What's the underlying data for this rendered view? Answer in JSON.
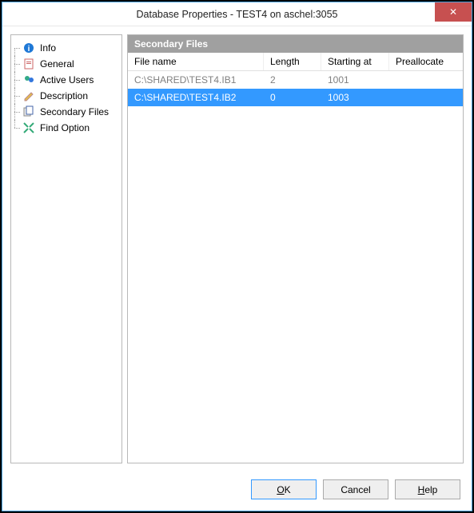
{
  "window": {
    "title": "Database Properties - TEST4 on aschel:3055"
  },
  "nav": {
    "items": [
      {
        "label": "Info"
      },
      {
        "label": "General"
      },
      {
        "label": "Active Users"
      },
      {
        "label": "Description"
      },
      {
        "label": "Secondary Files",
        "selected": true
      },
      {
        "label": "Find Option"
      }
    ]
  },
  "panel": {
    "title": "Secondary Files"
  },
  "table": {
    "columns": {
      "file_name": "File name",
      "length": "Length",
      "starting_at": "Starting at",
      "preallocate": "Preallocate"
    },
    "rows": [
      {
        "file_name": "C:\\SHARED\\TEST4.IB1",
        "length": "2",
        "starting_at": "1001",
        "preallocate": "",
        "selected": false
      },
      {
        "file_name": "C:\\SHARED\\TEST4.IB2",
        "length": "0",
        "starting_at": "1003",
        "preallocate": "",
        "selected": true
      }
    ]
  },
  "buttons": {
    "ok": "OK",
    "cancel": "Cancel",
    "help": "Help"
  }
}
